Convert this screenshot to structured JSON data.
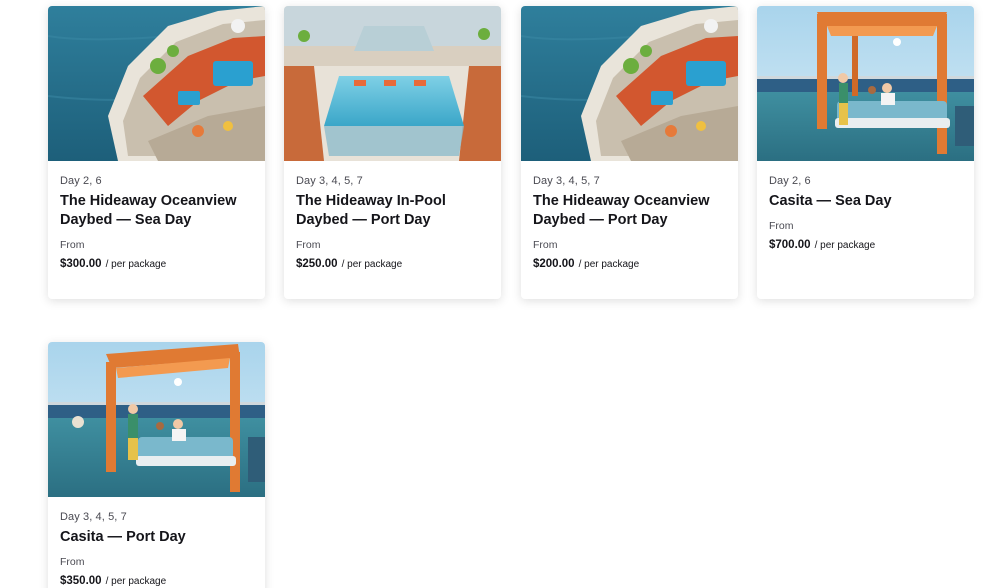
{
  "packages": [
    {
      "image": "ship-deck-oceanview-image",
      "days": "Day 2, 6",
      "title": "The Hideaway Oceanview Daybed — Sea Day",
      "from_label": "From",
      "price": "$300.00",
      "unit": "/ per package"
    },
    {
      "image": "ship-infinity-pool-image",
      "days": "Day 3, 4, 5, 7",
      "title": "The Hideaway In-Pool Daybed — Port Day",
      "from_label": "From",
      "price": "$250.00",
      "unit": "/ per package"
    },
    {
      "image": "ship-deck-oceanview-image",
      "days": "Day 3, 4, 5, 7",
      "title": "The Hideaway Oceanview Daybed — Port Day",
      "from_label": "From",
      "price": "$200.00",
      "unit": "/ per package"
    },
    {
      "image": "casita-cabana-image",
      "days": "Day 2, 6",
      "title": "Casita — Sea Day",
      "from_label": "From",
      "price": "$700.00",
      "unit": "/ per package"
    },
    {
      "image": "casita-cabana-image",
      "days": "Day 3, 4, 5, 7",
      "title": "Casita — Port Day",
      "from_label": "From",
      "price": "$350.00",
      "unit": "/ per package"
    }
  ]
}
